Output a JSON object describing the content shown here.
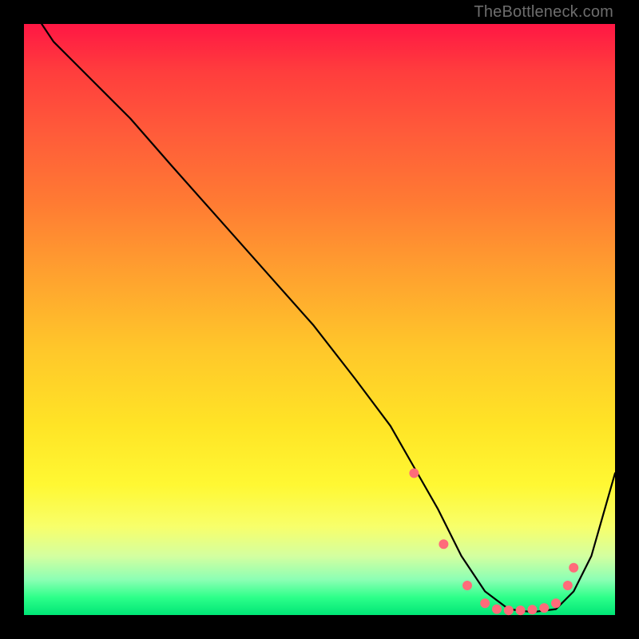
{
  "watermark": "TheBottleneck.com",
  "chart_data": {
    "type": "line",
    "title": "",
    "xlabel": "",
    "ylabel": "",
    "xlim": [
      0,
      100
    ],
    "ylim": [
      0,
      100
    ],
    "series": [
      {
        "name": "curve",
        "x": [
          3,
          5,
          8,
          12,
          18,
          25,
          33,
          41,
          49,
          56,
          62,
          66,
          70,
          74,
          78,
          82,
          86,
          90,
          93,
          96,
          98,
          100
        ],
        "values": [
          100,
          97,
          94,
          90,
          84,
          76,
          67,
          58,
          49,
          40,
          32,
          25,
          18,
          10,
          4,
          1,
          0.5,
          1,
          4,
          10,
          17,
          24
        ]
      }
    ],
    "markers": {
      "name": "highlight-points",
      "x": [
        66,
        71,
        75,
        78,
        80,
        82,
        84,
        86,
        88,
        90,
        92,
        93
      ],
      "values": [
        24,
        12,
        5,
        2,
        1,
        0.8,
        0.8,
        0.9,
        1.2,
        2,
        5,
        8
      ]
    },
    "gradient_background": {
      "orientation": "vertical",
      "stops": [
        {
          "pos": 0.0,
          "color": "#ff1744"
        },
        {
          "pos": 0.3,
          "color": "#ff7a33"
        },
        {
          "pos": 0.55,
          "color": "#ffc72a"
        },
        {
          "pos": 0.78,
          "color": "#fff833"
        },
        {
          "pos": 0.94,
          "color": "#8cffb4"
        },
        {
          "pos": 1.0,
          "color": "#00e676"
        }
      ]
    }
  }
}
